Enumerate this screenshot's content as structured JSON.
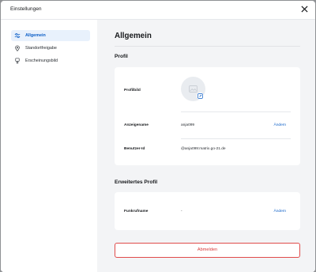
{
  "dialog": {
    "title": "Einstellungen",
    "close_icon": "close-icon"
  },
  "sidebar": {
    "items": [
      {
        "label": "Allgemein",
        "icon": "sliders-icon",
        "active": true
      },
      {
        "label": "Standortfreigabe",
        "icon": "location-pin-icon",
        "active": false
      },
      {
        "label": "Erscheinungsbild",
        "icon": "brush-icon",
        "active": false
      }
    ]
  },
  "main": {
    "title": "Allgemein",
    "profile": {
      "section_title": "Profil",
      "avatar_label": "Profilbild",
      "display_name_label": "Anzeigename",
      "display_name_value": "anja099",
      "display_name_action": "Ändern",
      "user_id_label": "Benutzer-Id",
      "user_id_value": "@anja099:matrix.go-21.de"
    },
    "advanced_profile": {
      "section_title": "Erweitertes Profil",
      "radio_name_label": "Funkrufname",
      "radio_name_value": "-",
      "radio_name_action": "Ändern"
    },
    "logout_label": "Abmelden"
  },
  "colors": {
    "accent": "#0b5ec7",
    "danger": "#d93a3a",
    "active_bg": "#e8f1fc"
  }
}
